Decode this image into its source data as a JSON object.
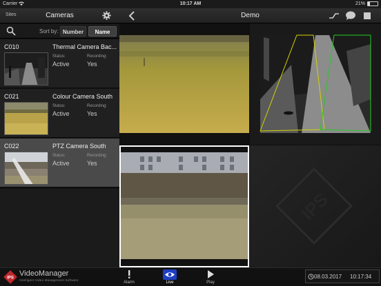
{
  "status_bar": {
    "carrier": "Carrier",
    "time": "10:17 AM",
    "battery": "21%",
    "battery_level": 0.21
  },
  "left_panel": {
    "sites_label": "Sites",
    "title": "Cameras",
    "sort_label": "Sort by:",
    "sort_options": [
      "Number",
      "Name"
    ],
    "sort_selected": "Name",
    "cameras": [
      {
        "code": "C010",
        "name": "Thermal Camera Bac...",
        "status_label": "Status:",
        "status": "Active",
        "recording_label": "Recording:",
        "recording": "Yes",
        "selected": false
      },
      {
        "code": "C021",
        "name": "Colour Camera South",
        "status_label": "Status:",
        "status": "Active",
        "recording_label": "Recording:",
        "recording": "Yes",
        "selected": false
      },
      {
        "code": "C022",
        "name": "PTZ Camera South",
        "status_label": "Status:",
        "status": "Active",
        "recording_label": "Recording:",
        "recording": "Yes",
        "selected": true
      }
    ]
  },
  "right_panel": {
    "title": "Demo",
    "icons": [
      "back-chevron-icon",
      "link-icon",
      "chat-bubble-icon",
      "stop-square-icon"
    ]
  },
  "video_grid": {
    "watermark": "IPS",
    "tiles": [
      "grass-field-feed",
      "thermal-path-feed",
      "building-field-feed",
      "empty-slot"
    ]
  },
  "bottom_bar": {
    "brand": "VideoManager",
    "tagline": "Intelligent Video Management Software",
    "logo_text": "IPS",
    "tabs": [
      {
        "label": "Alarm",
        "icon": "exclamation-icon",
        "active": false
      },
      {
        "label": "Live",
        "icon": "eye-icon",
        "active": true
      },
      {
        "label": "Play",
        "icon": "play-icon",
        "active": false
      }
    ],
    "date": "08.03.2017",
    "time": "10:17:34"
  },
  "colors": {
    "accent_tab": "#1f3fc4",
    "thermal_zone_yellow": "#d4d400",
    "thermal_zone_green": "#22cc22"
  }
}
